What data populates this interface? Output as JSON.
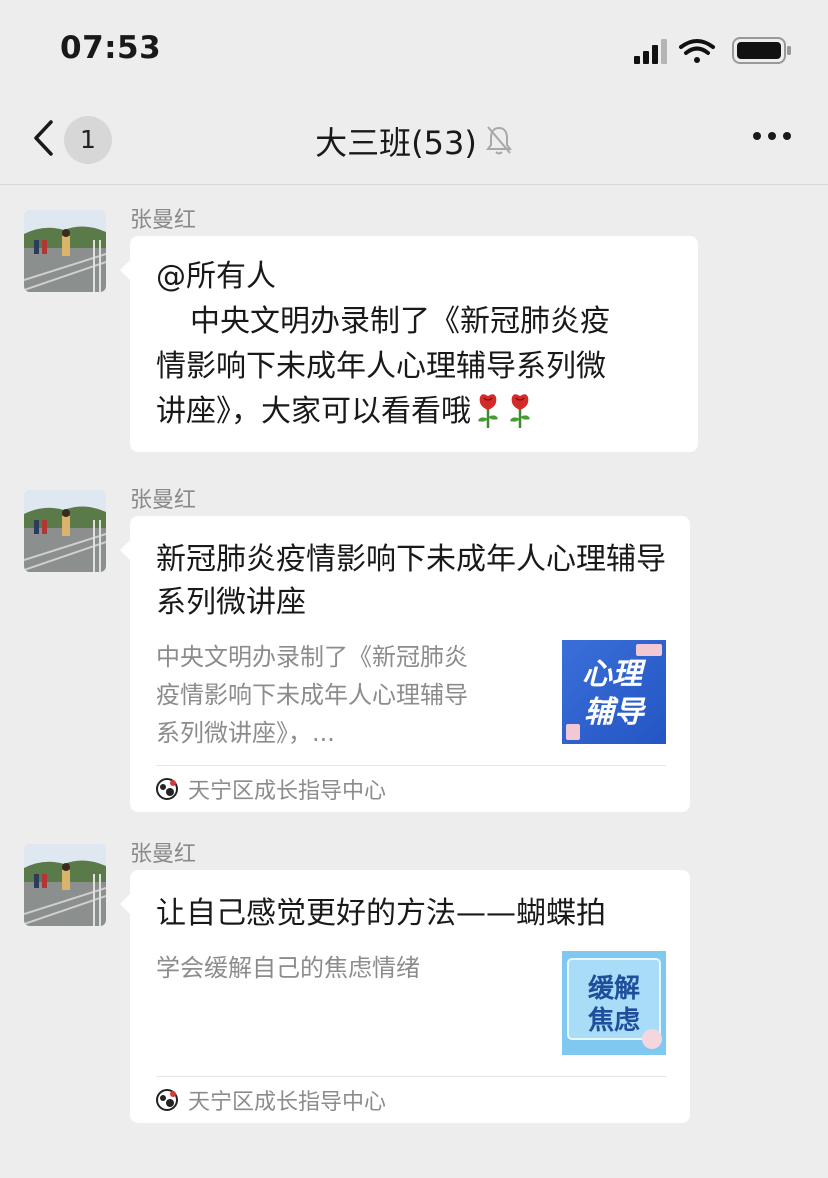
{
  "status_bar": {
    "time": "07:53"
  },
  "nav": {
    "back_count": "1",
    "title": "大三班(53)"
  },
  "messages": [
    {
      "sender": "张曼红",
      "lines": [
        "@所有人",
        "中央文明办录制了《新冠肺炎疫",
        "情影响下未成年人心理辅导系列微",
        "讲座》，大家可以看看哦"
      ]
    },
    {
      "sender": "张曼红",
      "card": {
        "title": "新冠肺炎疫情影响下未成年人心理辅导系列微讲座",
        "description": "中央文明办录制了《新冠肺炎疫情影响下未成年人心理辅导系列微讲座》，...",
        "thumb_text": [
          "心理",
          "辅导"
        ],
        "source": "天宁区成长指导中心"
      }
    },
    {
      "sender": "张曼红",
      "card": {
        "title": "让自己感觉更好的方法——蝴蝶拍",
        "description": "学会缓解自己的焦虑情绪",
        "thumb_text": [
          "缓解",
          "焦虑"
        ],
        "source": "天宁区成长指导中心"
      }
    }
  ],
  "colors": {
    "background": "#ededed",
    "bubble": "#ffffff",
    "secondary_text": "#8c8c8c"
  }
}
